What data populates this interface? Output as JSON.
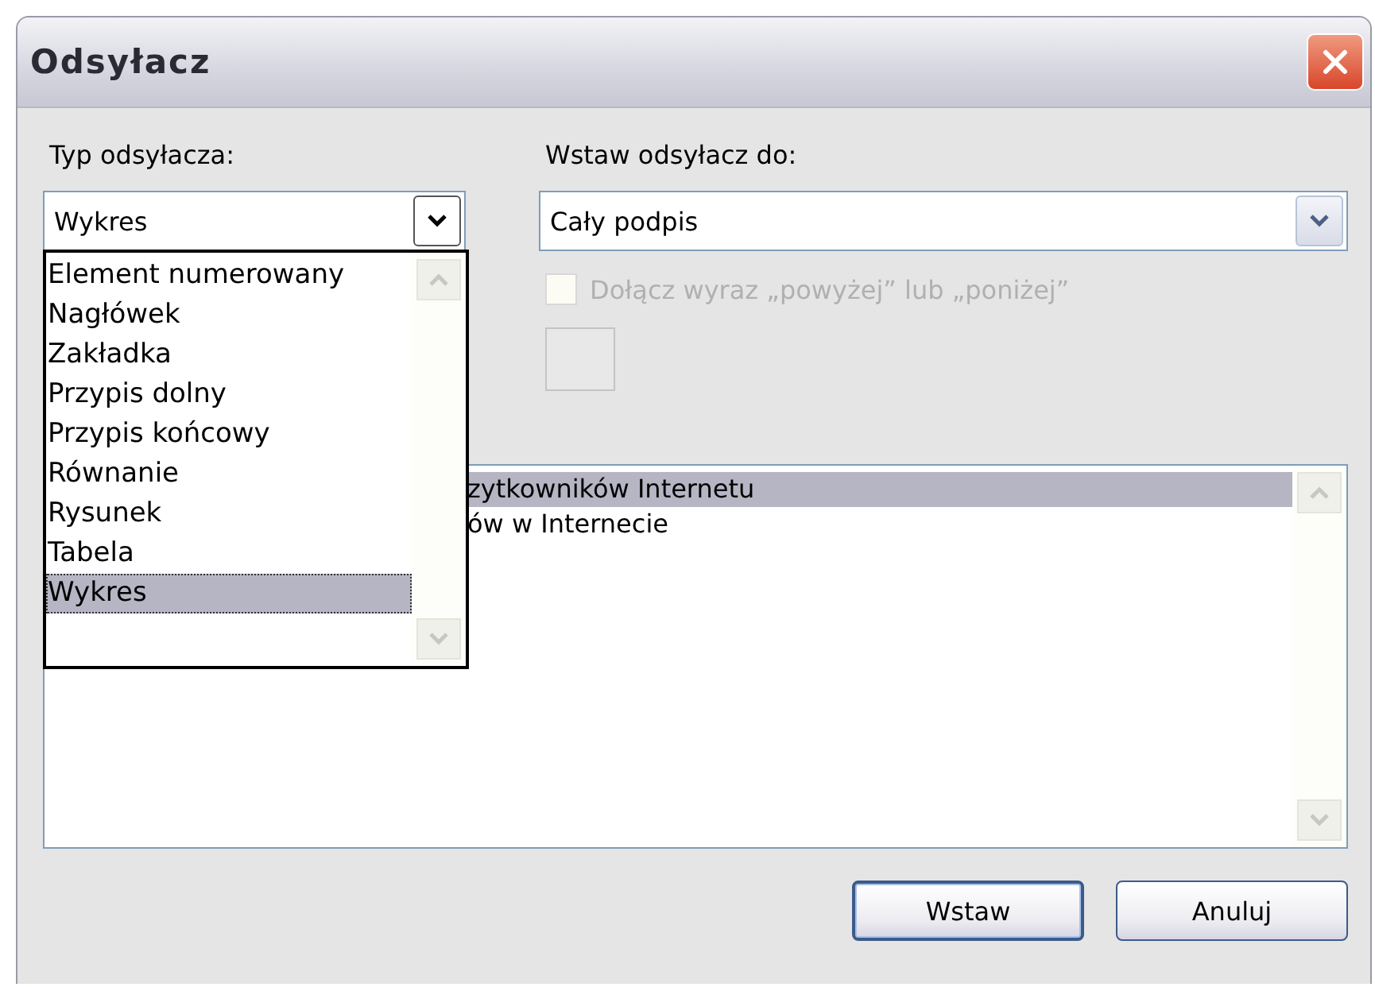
{
  "window": {
    "title": "Odsyłacz"
  },
  "reference_type": {
    "label": "Typ odsyłacza:",
    "value": "Wykres",
    "expanded": true,
    "options": [
      {
        "label": "Element numerowany",
        "selected": false
      },
      {
        "label": "Nagłówek",
        "selected": false
      },
      {
        "label": "Zakładka",
        "selected": false
      },
      {
        "label": "Przypis dolny",
        "selected": false
      },
      {
        "label": "Przypis końcowy",
        "selected": false
      },
      {
        "label": "Równanie",
        "selected": false
      },
      {
        "label": "Rysunek",
        "selected": false
      },
      {
        "label": "Tabela",
        "selected": false
      },
      {
        "label": "Wykres",
        "selected": true
      }
    ]
  },
  "insert_reference_to": {
    "label": "Wstaw odsyłacz do:",
    "value": "Cały podpis"
  },
  "include_above_below": {
    "label": "Dołącz wyraz „powyżej” lub „poniżej”",
    "checked": false,
    "disabled": true
  },
  "caption_list": {
    "items": [
      {
        "text": "zytkowników Internetu",
        "selected": true
      },
      {
        "text": "ów w Internecie",
        "selected": false
      }
    ]
  },
  "buttons": [
    {
      "label": "Wstaw",
      "default": true
    },
    {
      "label": "Anuluj",
      "default": false
    }
  ]
}
